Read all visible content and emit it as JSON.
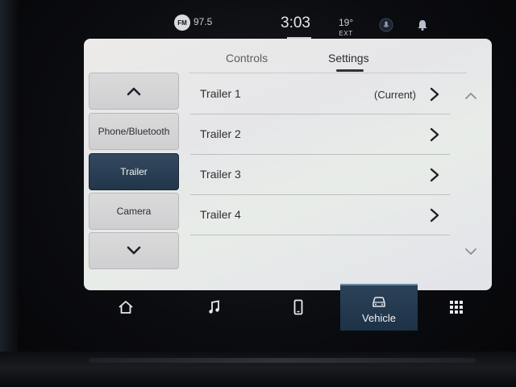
{
  "status_bar": {
    "band": "FM",
    "frequency": "97.5",
    "time": "3:03",
    "temperature": "19°",
    "temperature_label": "EXT",
    "icons": [
      "microphone-icon",
      "notification-bell-icon"
    ]
  },
  "tabs": [
    {
      "label": "Controls",
      "active": false
    },
    {
      "label": "Settings",
      "active": true
    }
  ],
  "side_nav": {
    "scroll_up_icon": "chevron-up-icon",
    "items": [
      {
        "label": "Phone/Bluetooth",
        "selected": false
      },
      {
        "label": "Trailer",
        "selected": true
      },
      {
        "label": "Camera",
        "selected": false
      }
    ],
    "scroll_down_icon": "chevron-down-icon"
  },
  "trailer_list": [
    {
      "label": "Trailer 1",
      "status": "(Current)"
    },
    {
      "label": "Trailer 2",
      "status": ""
    },
    {
      "label": "Trailer 3",
      "status": ""
    },
    {
      "label": "Trailer 4",
      "status": ""
    }
  ],
  "dock": {
    "items": [
      {
        "icon": "home-icon",
        "label": ""
      },
      {
        "icon": "music-note-icon",
        "label": ""
      },
      {
        "icon": "phone-icon",
        "label": ""
      },
      {
        "icon": "vehicle-icon",
        "label": "Vehicle",
        "active": true
      },
      {
        "icon": "apps-grid-icon",
        "label": ""
      }
    ]
  },
  "colors": {
    "accent": "#22364a",
    "screen_bg": "#e8e8ea",
    "text": "#2d2f34"
  }
}
